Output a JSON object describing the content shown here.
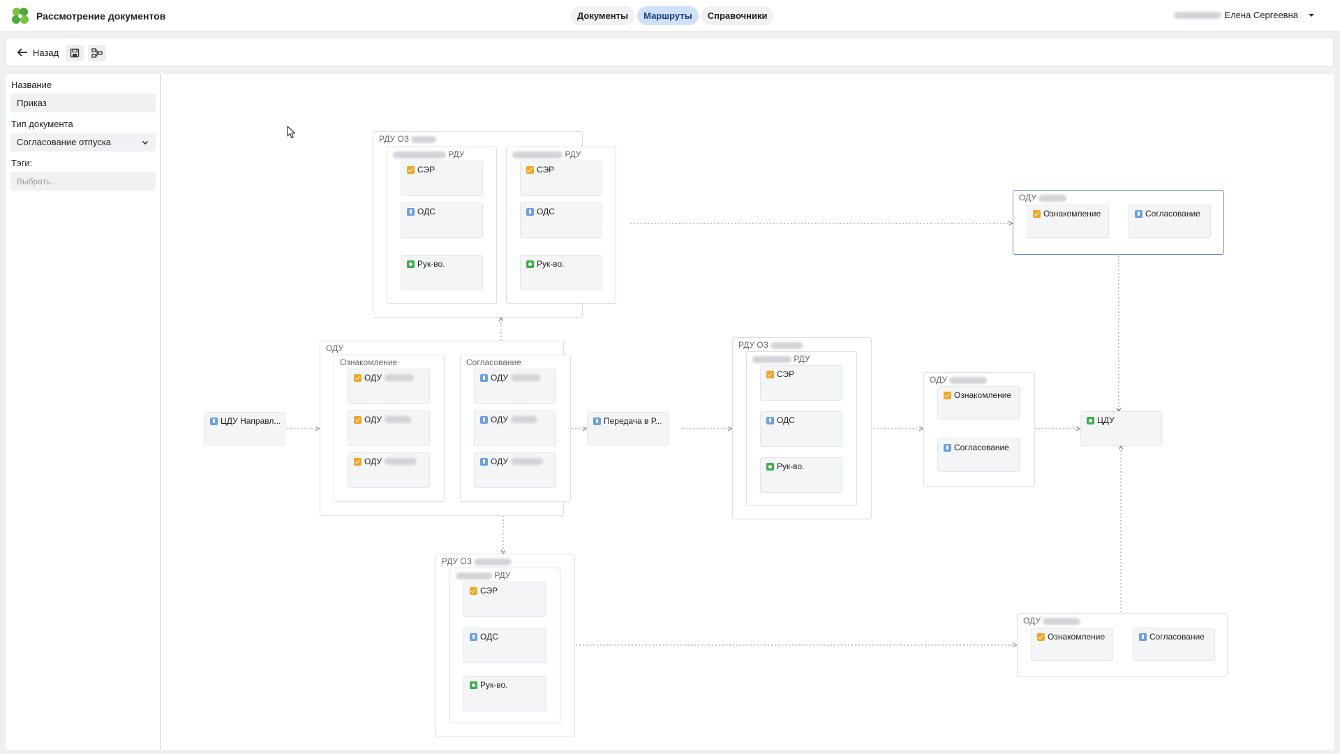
{
  "app": {
    "title": "Рассмотрение документов",
    "tabs": [
      {
        "label": "Документы"
      },
      {
        "label": "Маршруты"
      },
      {
        "label": "Справочники"
      }
    ],
    "user_name": "Елена Сергеевна"
  },
  "toolbar": {
    "back_label": "Назад"
  },
  "form": {
    "name_label": "Название",
    "name_value": "Приказ",
    "doctype_label": "Тип документа",
    "doctype_value": "Согласование отпуска",
    "tags_label": "Тэги:",
    "tags_placeholder": "Выбрать..."
  },
  "diagram": {
    "rdu_top": {
      "title": "РДУ ОЗ",
      "sub1_title": "РДУ",
      "sub2_title": "РДУ",
      "s1": [
        "СЭР",
        "ОДС",
        "Рук-во."
      ],
      "s2": [
        "СЭР",
        "ОДС",
        "Рук-во."
      ]
    },
    "start_node": "ЦДУ Направл...",
    "odu_main": {
      "title": "ОДУ",
      "col1_title": "Ознакомление",
      "col2_title": "Согласование",
      "col1": [
        "ОДУ",
        "ОДУ",
        "ОДУ"
      ],
      "col2": [
        "ОДУ",
        "ОДУ",
        "ОДУ"
      ]
    },
    "transfer_node": "Передача в Р...",
    "rdu_mid": {
      "title": "РДУ ОЗ",
      "sub_title": "РДУ",
      "items": [
        "СЭР",
        "ОДС",
        "Рук-во."
      ]
    },
    "odu_mid": {
      "title": "ОДУ",
      "items": [
        "Ознакомление",
        "Согласование"
      ]
    },
    "cdu_node": "ЦДУ",
    "odu_topright": {
      "title": "ОДУ",
      "items": [
        "Ознакомление",
        "Согласование"
      ]
    },
    "rdu_bottom": {
      "title": "РДУ ОЗ",
      "sub_title": "РДУ",
      "items": [
        "СЭР",
        "ОДС",
        "Рук-во."
      ]
    },
    "odu_bottomright": {
      "title": "ОДУ",
      "items": [
        "Ознакомление",
        "Согласование"
      ]
    }
  }
}
